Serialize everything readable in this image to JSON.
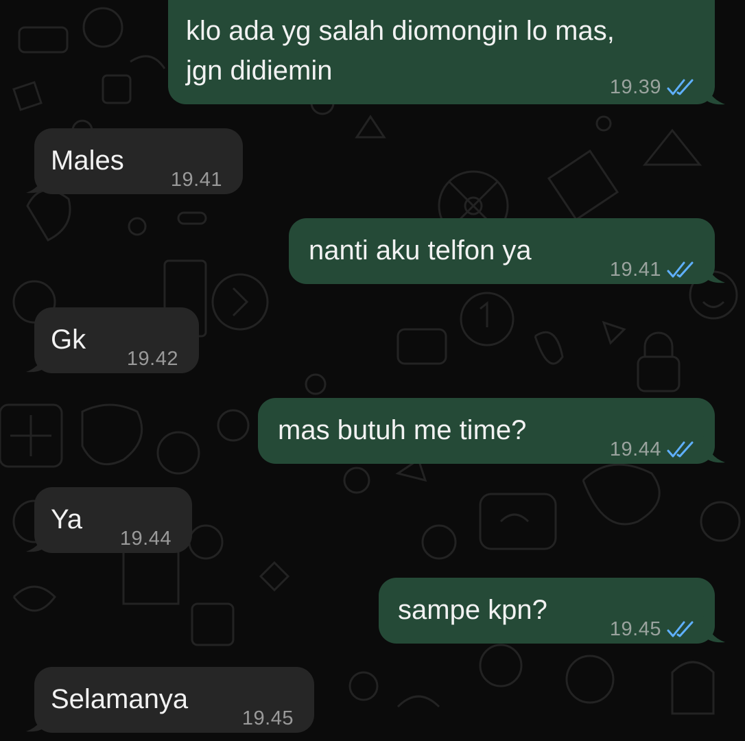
{
  "colors": {
    "background": "#0b0b0b",
    "incoming_bubble": "#262626",
    "outgoing_bubble": "#254a37",
    "read_ticks": "#5fb0ff",
    "doodle": "#262626"
  },
  "messages": [
    {
      "direction": "outgoing",
      "text": [
        "klo ada yg salah diomongin lo mas,",
        "jgn didiemin"
      ],
      "time": "19.39",
      "status": "read"
    },
    {
      "direction": "incoming",
      "text": [
        "Males"
      ],
      "time": "19.41"
    },
    {
      "direction": "outgoing",
      "text": [
        "nanti aku telfon ya"
      ],
      "time": "19.41",
      "status": "read"
    },
    {
      "direction": "incoming",
      "text": [
        "Gk"
      ],
      "time": "19.42"
    },
    {
      "direction": "outgoing",
      "text": [
        "mas butuh me time?"
      ],
      "time": "19.44",
      "status": "read"
    },
    {
      "direction": "incoming",
      "text": [
        "Ya"
      ],
      "time": "19.44"
    },
    {
      "direction": "outgoing",
      "text": [
        "sampe kpn?"
      ],
      "time": "19.45",
      "status": "read"
    },
    {
      "direction": "incoming",
      "text": [
        "Selamanya"
      ],
      "time": "19.45"
    }
  ]
}
